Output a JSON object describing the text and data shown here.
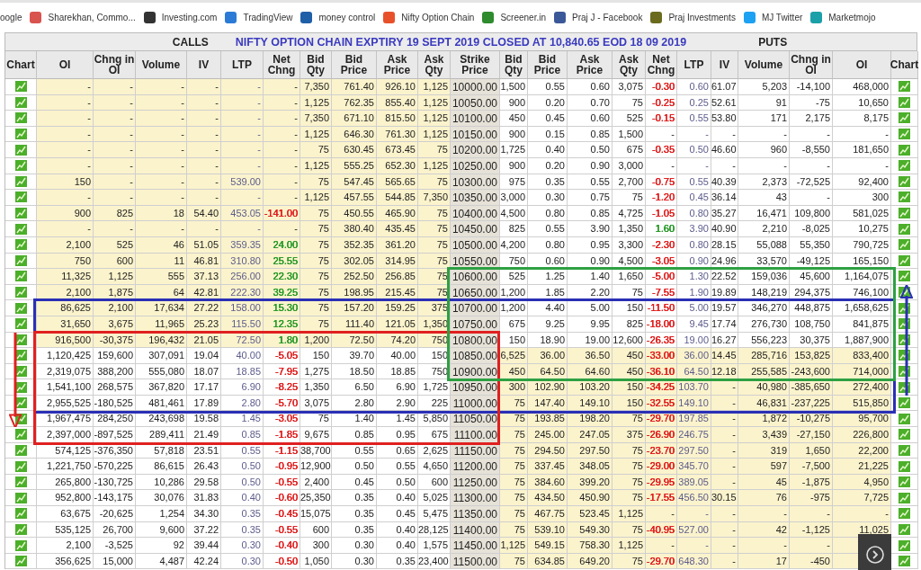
{
  "bookmarks": [
    {
      "label": "oogle"
    },
    {
      "label": "Sharekhan, Commo...",
      "color": "#d9534f"
    },
    {
      "label": "Investing.com",
      "color": "#333333"
    },
    {
      "label": "TradingView",
      "color": "#2b7bd6"
    },
    {
      "label": "money control",
      "color": "#1f5fa8"
    },
    {
      "label": "Nifty Option Chain",
      "color": "#e8502a"
    },
    {
      "label": "Screener.in",
      "color": "#2e8b2e"
    },
    {
      "label": "Praj J - Facebook",
      "color": "#3b5998"
    },
    {
      "label": "Praj Investments",
      "color": "#6b6b1f"
    },
    {
      "label": "MJ Twitter",
      "color": "#1da1f2"
    },
    {
      "label": "Marketmojo",
      "color": "#1aa0a8"
    }
  ],
  "header": {
    "calls_label": "CALLS",
    "title": "NIFTY OPTION CHAIN EXPTIRY 19 SEPT 2019 CLOSED AT 10,840.65 EOD 18 09 2019",
    "puts_label": "PUTS"
  },
  "columns": [
    "Chart",
    "OI",
    "Chng in OI",
    "Volume",
    "IV",
    "LTP",
    "Net Chng",
    "Bid Qty",
    "Bid Price",
    "Ask Price",
    "Ask Qty",
    "Strike Price",
    "Bid Qty",
    "Bid Price",
    "Ask Price",
    "Ask Qty",
    "Net Chng",
    "LTP",
    "IV",
    "Volume",
    "Chng in OI",
    "OI",
    "Chart"
  ],
  "rows": [
    {
      "strike": "10000.00",
      "calls_itm": true,
      "puts_itm": false,
      "calls": [
        "-",
        "-",
        "-",
        "-",
        "-",
        "-",
        "7,350",
        "761.40",
        "926.10",
        "1,125"
      ],
      "puts": [
        "1,500",
        "0.55",
        "0.60",
        "3,075",
        {
          "text": "-0.30",
          "color": "#e02020"
        },
        "0.60",
        "61.07",
        "5,203",
        "-14,100",
        "468,000"
      ]
    },
    {
      "strike": "10050.00",
      "calls_itm": true,
      "puts_itm": false,
      "calls": [
        "-",
        "-",
        "-",
        "-",
        "-",
        "-",
        "1,125",
        "762.35",
        "855.40",
        "1,125"
      ],
      "puts": [
        "900",
        "0.20",
        "0.70",
        "75",
        {
          "text": "-0.25",
          "color": "#e02020"
        },
        "0.25",
        "52.61",
        "91",
        "-75",
        "10,650"
      ]
    },
    {
      "strike": "10100.00",
      "calls_itm": true,
      "puts_itm": false,
      "calls": [
        "-",
        "-",
        "-",
        "-",
        "-",
        "-",
        "7,350",
        "671.10",
        "815.50",
        "1,125"
      ],
      "puts": [
        "450",
        "0.45",
        "0.60",
        "525",
        {
          "text": "-0.15",
          "color": "#e02020"
        },
        "0.55",
        "53.80",
        "171",
        "2,175",
        "8,175"
      ]
    },
    {
      "strike": "10150.00",
      "calls_itm": true,
      "puts_itm": false,
      "calls": [
        "-",
        "-",
        "-",
        "-",
        "-",
        "-",
        "1,125",
        "646.30",
        "761.30",
        "1,125"
      ],
      "puts": [
        "900",
        "0.15",
        "0.85",
        "1,500",
        "-",
        "-",
        "-",
        "-",
        "-",
        "-"
      ]
    },
    {
      "strike": "10200.00",
      "calls_itm": true,
      "puts_itm": false,
      "calls": [
        "-",
        "-",
        "-",
        "-",
        "-",
        "-",
        "75",
        "630.45",
        "673.45",
        "75"
      ],
      "puts": [
        "1,725",
        "0.40",
        "0.50",
        "675",
        {
          "text": "-0.35",
          "color": "#e02020"
        },
        "0.50",
        "46.60",
        "960",
        "-8,550",
        "181,650"
      ]
    },
    {
      "strike": "10250.00",
      "calls_itm": true,
      "puts_itm": false,
      "calls": [
        "-",
        "-",
        "-",
        "-",
        "-",
        "-",
        "1,125",
        "555.25",
        "652.30",
        "1,125"
      ],
      "puts": [
        "900",
        "0.20",
        "0.90",
        "3,000",
        "-",
        "-",
        "-",
        "-",
        "-",
        "-"
      ]
    },
    {
      "strike": "10300.00",
      "calls_itm": true,
      "puts_itm": false,
      "calls": [
        "150",
        "-",
        "-",
        "-",
        "539.00",
        "-",
        "75",
        "547.45",
        "565.65",
        "75"
      ],
      "puts": [
        "975",
        "0.35",
        "0.55",
        "2,700",
        {
          "text": "-0.75",
          "color": "#e02020"
        },
        "0.55",
        "40.39",
        "2,373",
        "-72,525",
        "92,400"
      ]
    },
    {
      "strike": "10350.00",
      "calls_itm": true,
      "puts_itm": false,
      "calls": [
        "-",
        "-",
        "-",
        "-",
        "-",
        "-",
        "1,125",
        "457.55",
        "544.85",
        "7,350"
      ],
      "puts": [
        "3,000",
        "0.30",
        "0.75",
        "75",
        {
          "text": "-1.20",
          "color": "#e02020"
        },
        "0.45",
        "36.14",
        "43",
        "-",
        "300"
      ]
    },
    {
      "strike": "10400.00",
      "calls_itm": true,
      "puts_itm": false,
      "calls": [
        "900",
        "825",
        "18",
        "54.40",
        "453.05",
        {
          "text": "-141.00",
          "color": "#e02020"
        },
        "75",
        "450.55",
        "465.90",
        "75"
      ],
      "puts": [
        "4,500",
        "0.80",
        "0.85",
        "4,725",
        {
          "text": "-1.05",
          "color": "#e02020"
        },
        "0.80",
        "35.27",
        "16,471",
        "109,800",
        "581,025"
      ]
    },
    {
      "strike": "10450.00",
      "calls_itm": true,
      "puts_itm": false,
      "calls": [
        "-",
        "-",
        "-",
        "-",
        "-",
        "-",
        "75",
        "380.40",
        "435.45",
        "75"
      ],
      "puts": [
        "825",
        "0.55",
        "3.90",
        "1,350",
        {
          "text": "1.60",
          "color": "#2a9a2a"
        },
        "3.90",
        "40.90",
        "2,210",
        "-8,025",
        "10,275"
      ]
    },
    {
      "strike": "10500.00",
      "calls_itm": true,
      "puts_itm": false,
      "calls": [
        "2,100",
        "525",
        "46",
        "51.05",
        "359.35",
        {
          "text": "24.00",
          "color": "#2a9a2a"
        },
        "75",
        "352.35",
        "361.20",
        "75"
      ],
      "puts": [
        "4,200",
        "0.80",
        "0.95",
        "3,300",
        {
          "text": "-2.30",
          "color": "#e02020"
        },
        "0.80",
        "28.15",
        "55,088",
        "55,350",
        "790,725"
      ]
    },
    {
      "strike": "10550.00",
      "calls_itm": true,
      "puts_itm": false,
      "calls": [
        "750",
        "600",
        "11",
        "46.81",
        "310.80",
        {
          "text": "25.55",
          "color": "#2a9a2a"
        },
        "75",
        "302.05",
        "314.95",
        "75"
      ],
      "puts": [
        "750",
        "0.60",
        "0.90",
        "4,500",
        {
          "text": "-3.05",
          "color": "#e02020"
        },
        "0.90",
        "24.96",
        "33,570",
        "-49,125",
        "165,150"
      ]
    },
    {
      "strike": "10600.00",
      "calls_itm": true,
      "puts_itm": false,
      "calls": [
        "11,325",
        "1,125",
        "555",
        "37.13",
        "256.00",
        {
          "text": "22.30",
          "color": "#2a9a2a"
        },
        "75",
        "252.50",
        "256.85",
        "75"
      ],
      "puts": [
        "525",
        "1.25",
        "1.40",
        "1,650",
        {
          "text": "-5.00",
          "color": "#e02020"
        },
        "1.30",
        "22.52",
        "159,036",
        "45,600",
        "1,164,075"
      ]
    },
    {
      "strike": "10650.00",
      "calls_itm": true,
      "puts_itm": false,
      "calls": [
        "2,100",
        "1,875",
        "64",
        "42.81",
        "222.30",
        {
          "text": "39.25",
          "color": "#2a9a2a"
        },
        "75",
        "198.95",
        "215.45",
        "75"
      ],
      "puts": [
        "1,200",
        "1.85",
        "2.20",
        "75",
        {
          "text": "-7.55",
          "color": "#e02020"
        },
        "1.90",
        "19.89",
        "148,219",
        "294,375",
        "746,100"
      ]
    },
    {
      "strike": "10700.00",
      "calls_itm": true,
      "puts_itm": false,
      "calls": [
        "86,625",
        "2,100",
        "17,634",
        "27.22",
        "158.00",
        {
          "text": "15.30",
          "color": "#2a9a2a"
        },
        "75",
        "157.20",
        "159.25",
        "375"
      ],
      "puts": [
        "1,200",
        "4.40",
        "5.00",
        "150",
        {
          "text": "-11.50",
          "color": "#e02020"
        },
        "5.00",
        "19.57",
        "346,270",
        "448,875",
        "1,658,625"
      ]
    },
    {
      "strike": "10750.00",
      "calls_itm": true,
      "puts_itm": false,
      "calls": [
        "31,650",
        "3,675",
        "11,965",
        "25.23",
        "115.50",
        {
          "text": "12.35",
          "color": "#2a9a2a"
        },
        "75",
        "111.40",
        "121.05",
        "1,350"
      ],
      "puts": [
        "675",
        "9.25",
        "9.95",
        "825",
        {
          "text": "-18.00",
          "color": "#e02020"
        },
        "9.45",
        "17.74",
        "276,730",
        "108,750",
        "841,875"
      ]
    },
    {
      "strike": "10800.00",
      "calls_itm": true,
      "puts_itm": false,
      "calls": [
        "916,500",
        "-30,375",
        "196,432",
        "21.05",
        "72.50",
        {
          "text": "1.80",
          "color": "#2a9a2a"
        },
        "1,200",
        "72.50",
        "74.20",
        "750"
      ],
      "puts": [
        "150",
        "18.90",
        "19.00",
        "12,600",
        {
          "text": "-26.35",
          "color": "#e02020"
        },
        "19.00",
        "16.27",
        "556,223",
        "30,375",
        "1,887,900"
      ]
    },
    {
      "strike": "10850.00",
      "calls_itm": false,
      "puts_itm": true,
      "calls": [
        "1,120,425",
        "159,600",
        "307,091",
        "19.04",
        "40.00",
        {
          "text": "-5.05",
          "color": "#e02020"
        },
        "150",
        "39.70",
        "40.00",
        "150"
      ],
      "puts": [
        "6,525",
        "36.00",
        "36.50",
        "450",
        {
          "text": "-33.00",
          "color": "#e02020"
        },
        "36.00",
        "14.45",
        "285,716",
        "153,825",
        "833,400"
      ]
    },
    {
      "strike": "10900.00",
      "calls_itm": false,
      "puts_itm": true,
      "calls": [
        "2,319,075",
        "388,200",
        "555,080",
        "18.07",
        "18.85",
        {
          "text": "-7.95",
          "color": "#e02020"
        },
        "1,275",
        "18.50",
        "18.85",
        "750"
      ],
      "puts": [
        "450",
        "64.50",
        "64.60",
        "450",
        {
          "text": "-36.10",
          "color": "#e02020"
        },
        "64.50",
        "12.18",
        "255,585",
        "-243,600",
        "714,000"
      ]
    },
    {
      "strike": "10950.00",
      "calls_itm": false,
      "puts_itm": true,
      "calls": [
        "1,541,100",
        "268,575",
        "367,820",
        "17.17",
        "6.90",
        {
          "text": "-8.25",
          "color": "#e02020"
        },
        "1,350",
        "6.50",
        "6.90",
        "1,725"
      ],
      "puts": [
        "300",
        "102.90",
        "103.20",
        "150",
        {
          "text": "-34.25",
          "color": "#e02020"
        },
        "103.70",
        "-",
        "40,980",
        "-385,650",
        "272,400"
      ]
    },
    {
      "strike": "11000.00",
      "calls_itm": false,
      "puts_itm": true,
      "calls": [
        "2,955,525",
        "-180,525",
        "481,461",
        "17.89",
        "2.80",
        {
          "text": "-5.70",
          "color": "#e02020"
        },
        "3,075",
        "2.80",
        "2.90",
        "225"
      ],
      "puts": [
        "75",
        "147.40",
        "149.10",
        "150",
        {
          "text": "-32.55",
          "color": "#e02020"
        },
        "149.10",
        "-",
        "46,831",
        "-237,225",
        "515,850"
      ]
    },
    {
      "strike": "11050.00",
      "calls_itm": false,
      "puts_itm": true,
      "calls": [
        "1,967,475",
        "284,250",
        "243,698",
        "19.58",
        "1.45",
        {
          "text": "-3.05",
          "color": "#e02020"
        },
        "75",
        "1.40",
        "1.45",
        "5,850"
      ],
      "puts": [
        "75",
        "193.85",
        "198.20",
        "75",
        {
          "text": "-29.70",
          "color": "#e02020"
        },
        "197.85",
        "-",
        "1,872",
        "-10,275",
        "95,700"
      ]
    },
    {
      "strike": "11100.00",
      "calls_itm": false,
      "puts_itm": true,
      "calls": [
        "2,397,000",
        "-897,525",
        "289,411",
        "21.49",
        "0.85",
        {
          "text": "-1.85",
          "color": "#e02020"
        },
        "9,675",
        "0.85",
        "0.95",
        "675"
      ],
      "puts": [
        "75",
        "245.00",
        "247.05",
        "375",
        {
          "text": "-26.90",
          "color": "#e02020"
        },
        "246.75",
        "-",
        "3,439",
        "-27,150",
        "226,800"
      ]
    },
    {
      "strike": "11150.00",
      "calls_itm": false,
      "puts_itm": true,
      "calls": [
        "574,125",
        "-376,350",
        "57,818",
        "23.51",
        "0.55",
        {
          "text": "-1.15",
          "color": "#e02020"
        },
        "38,700",
        "0.55",
        "0.65",
        "2,625"
      ],
      "puts": [
        "75",
        "294.50",
        "297.50",
        "75",
        {
          "text": "-23.70",
          "color": "#e02020"
        },
        "297.50",
        "-",
        "319",
        "1,650",
        "22,200"
      ]
    },
    {
      "strike": "11200.00",
      "calls_itm": false,
      "puts_itm": true,
      "calls": [
        "1,221,750",
        "-570,225",
        "86,615",
        "26.43",
        "0.50",
        {
          "text": "-0.95",
          "color": "#e02020"
        },
        "12,900",
        "0.50",
        "0.55",
        "4,650"
      ],
      "puts": [
        "75",
        "337.45",
        "348.05",
        "75",
        {
          "text": "-29.00",
          "color": "#e02020"
        },
        "345.70",
        "-",
        "597",
        "-7,500",
        "21,225"
      ]
    },
    {
      "strike": "11250.00",
      "calls_itm": false,
      "puts_itm": true,
      "calls": [
        "265,800",
        "-130,725",
        "10,286",
        "29.58",
        "0.50",
        {
          "text": "-0.55",
          "color": "#e02020"
        },
        "2,400",
        "0.45",
        "0.50",
        "600"
      ],
      "puts": [
        "75",
        "384.60",
        "399.20",
        "75",
        {
          "text": "-29.95",
          "color": "#e02020"
        },
        "389.05",
        "-",
        "45",
        "-1,875",
        "4,950"
      ]
    },
    {
      "strike": "11300.00",
      "calls_itm": false,
      "puts_itm": true,
      "calls": [
        "952,800",
        "-143,175",
        "30,076",
        "31.83",
        "0.40",
        {
          "text": "-0.60",
          "color": "#e02020"
        },
        "25,350",
        "0.35",
        "0.40",
        "5,025"
      ],
      "puts": [
        "75",
        "434.50",
        "450.90",
        "75",
        {
          "text": "-17.55",
          "color": "#e02020"
        },
        "456.50",
        "30.15",
        "76",
        "-975",
        "7,725"
      ]
    },
    {
      "strike": "11350.00",
      "calls_itm": false,
      "puts_itm": true,
      "calls": [
        "63,675",
        "-20,625",
        "1,254",
        "34.30",
        "0.35",
        {
          "text": "-0.45",
          "color": "#e02020"
        },
        "15,075",
        "0.35",
        "0.45",
        "5,475"
      ],
      "puts": [
        "75",
        "467.75",
        "523.45",
        "1,125",
        "-",
        "-",
        "-",
        "-",
        "-",
        "-"
      ]
    },
    {
      "strike": "11400.00",
      "calls_itm": false,
      "puts_itm": true,
      "calls": [
        "535,125",
        "26,700",
        "9,600",
        "37.22",
        "0.35",
        {
          "text": "-0.55",
          "color": "#e02020"
        },
        "600",
        "0.35",
        "0.40",
        "28,125"
      ],
      "puts": [
        "75",
        "539.10",
        "549.30",
        "75",
        {
          "text": "-40.95",
          "color": "#e02020"
        },
        "527.00",
        "-",
        "42",
        "-1,125",
        "11,025"
      ]
    },
    {
      "strike": "11450.00",
      "calls_itm": false,
      "puts_itm": true,
      "calls": [
        "2,100",
        "-3,525",
        "92",
        "39.44",
        "0.30",
        {
          "text": "-0.40",
          "color": "#e02020"
        },
        "300",
        "0.30",
        "0.40",
        "1,575"
      ],
      "puts": [
        "1,125",
        "549.15",
        "758.30",
        "1,125",
        "-",
        "-",
        "-",
        "-",
        "-"
      ]
    },
    {
      "strike": "11500.00",
      "calls_itm": false,
      "puts_itm": true,
      "calls": [
        "356,625",
        "15,000",
        "4,487",
        "42.24",
        "0.30",
        {
          "text": "-0.50",
          "color": "#e02020"
        },
        "1,050",
        "0.30",
        "0.35",
        "23,400"
      ],
      "puts": [
        "75",
        "634.85",
        "649.20",
        "75",
        {
          "text": "-29.70",
          "color": "#e02020"
        },
        "648.30",
        "-",
        "17",
        "-450"
      ]
    }
  ],
  "annotations": [
    {
      "kind": "box",
      "color": "#2a2fb5"
    },
    {
      "kind": "box",
      "color": "#e02020"
    },
    {
      "kind": "box",
      "color": "#2ea043"
    },
    {
      "kind": "arrow",
      "color": "#e02020"
    },
    {
      "kind": "arrow",
      "color": "#2a2fb5"
    }
  ]
}
